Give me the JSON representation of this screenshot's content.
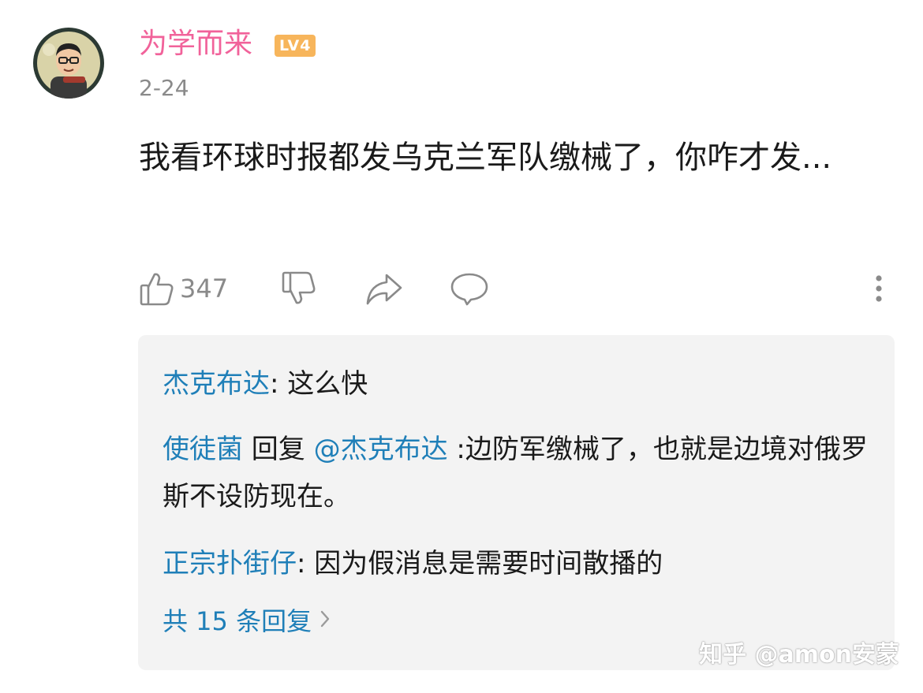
{
  "comment": {
    "username": "为学而来",
    "level_badge": "LV4",
    "date": "2-24",
    "text": "我看环球时报都发乌克兰军队缴械了，你咋才发...",
    "like_count": "347"
  },
  "replies": [
    {
      "author": "杰克布达",
      "sep": ": ",
      "text": "这么快"
    },
    {
      "author": "使徒菌",
      "reply_word": " 回复 ",
      "mention": "@杰克布达",
      "text": " :边防军缴械了，也就是边境对俄罗斯不设防现在。"
    },
    {
      "author": "正宗扑街仔",
      "sep": ": ",
      "text": "因为假消息是需要时间散播的"
    }
  ],
  "more_replies": "共 15 条回复",
  "watermark": "知乎 @amon安蒙",
  "icons": {
    "like": "thumbs-up-icon",
    "dislike": "thumbs-down-icon",
    "share": "share-icon",
    "reply": "comment-bubble-icon",
    "more": "more-vertical-icon",
    "chevron": "chevron-right-icon"
  },
  "colors": {
    "username": "#f1629a",
    "badge": "#f7b55b",
    "link": "#1f7fb8",
    "muted": "#8a8a8a",
    "reply_bg": "#f3f3f3"
  }
}
